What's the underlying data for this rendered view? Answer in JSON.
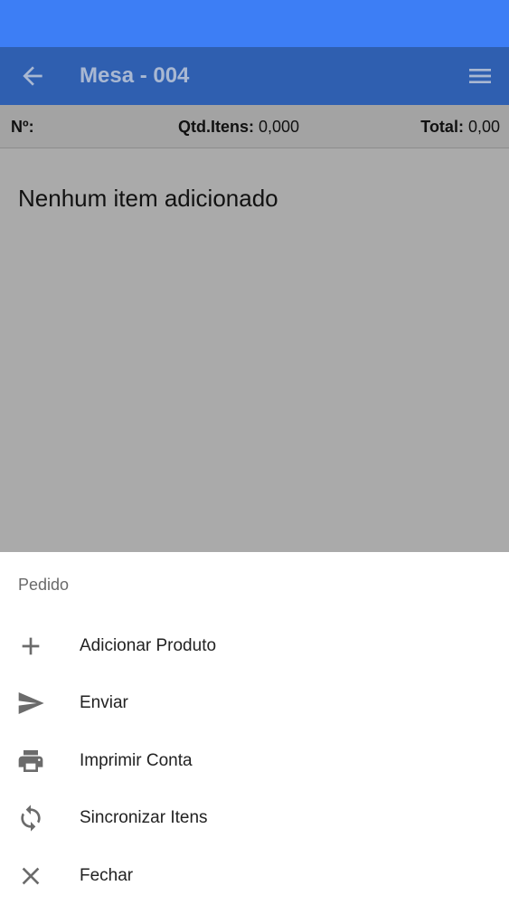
{
  "colors": {
    "status_bar": "#3d7ef5",
    "app_bar": "#2f5fb0",
    "app_bar_text": "#a9b8d2",
    "scrim_content": "#aaaaaa",
    "sheet_bg": "#ffffff"
  },
  "header": {
    "back_icon": "arrow-back-icon",
    "title": "Mesa - 004",
    "menu_icon": "hamburger-menu-icon"
  },
  "summary": {
    "num_label": "Nº:",
    "qtd_label": "Qtd.Itens:",
    "qtd_value": "0,000",
    "total_label": "Total:",
    "total_value": "0,00"
  },
  "content": {
    "empty_message": "Nenhum item adicionado"
  },
  "sheet": {
    "heading": "Pedido",
    "items": [
      {
        "label": "Adicionar Produto",
        "icon": "plus-icon"
      },
      {
        "label": "Enviar",
        "icon": "send-icon"
      },
      {
        "label": "Imprimir Conta",
        "icon": "printer-icon"
      },
      {
        "label": "Sincronizar Itens",
        "icon": "sync-icon"
      },
      {
        "label": "Fechar",
        "icon": "close-icon"
      }
    ]
  }
}
